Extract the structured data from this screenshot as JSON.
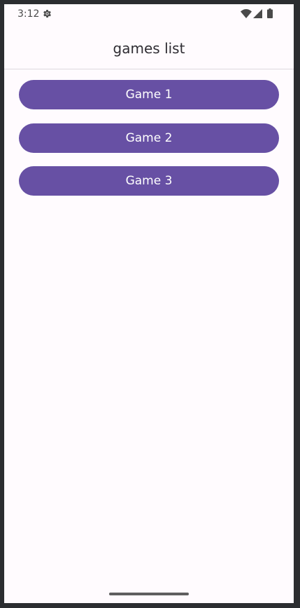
{
  "status_bar": {
    "time": "3:12",
    "icons": [
      "settings-icon",
      "wifi-icon",
      "signal-icon",
      "battery-icon"
    ]
  },
  "app_bar": {
    "title": "games list"
  },
  "games": [
    {
      "label": "Game 1"
    },
    {
      "label": "Game 2"
    },
    {
      "label": "Game 3"
    }
  ],
  "colors": {
    "accent": "#6750a4",
    "background": "#fffbfe",
    "frame": "#2b2d30"
  }
}
